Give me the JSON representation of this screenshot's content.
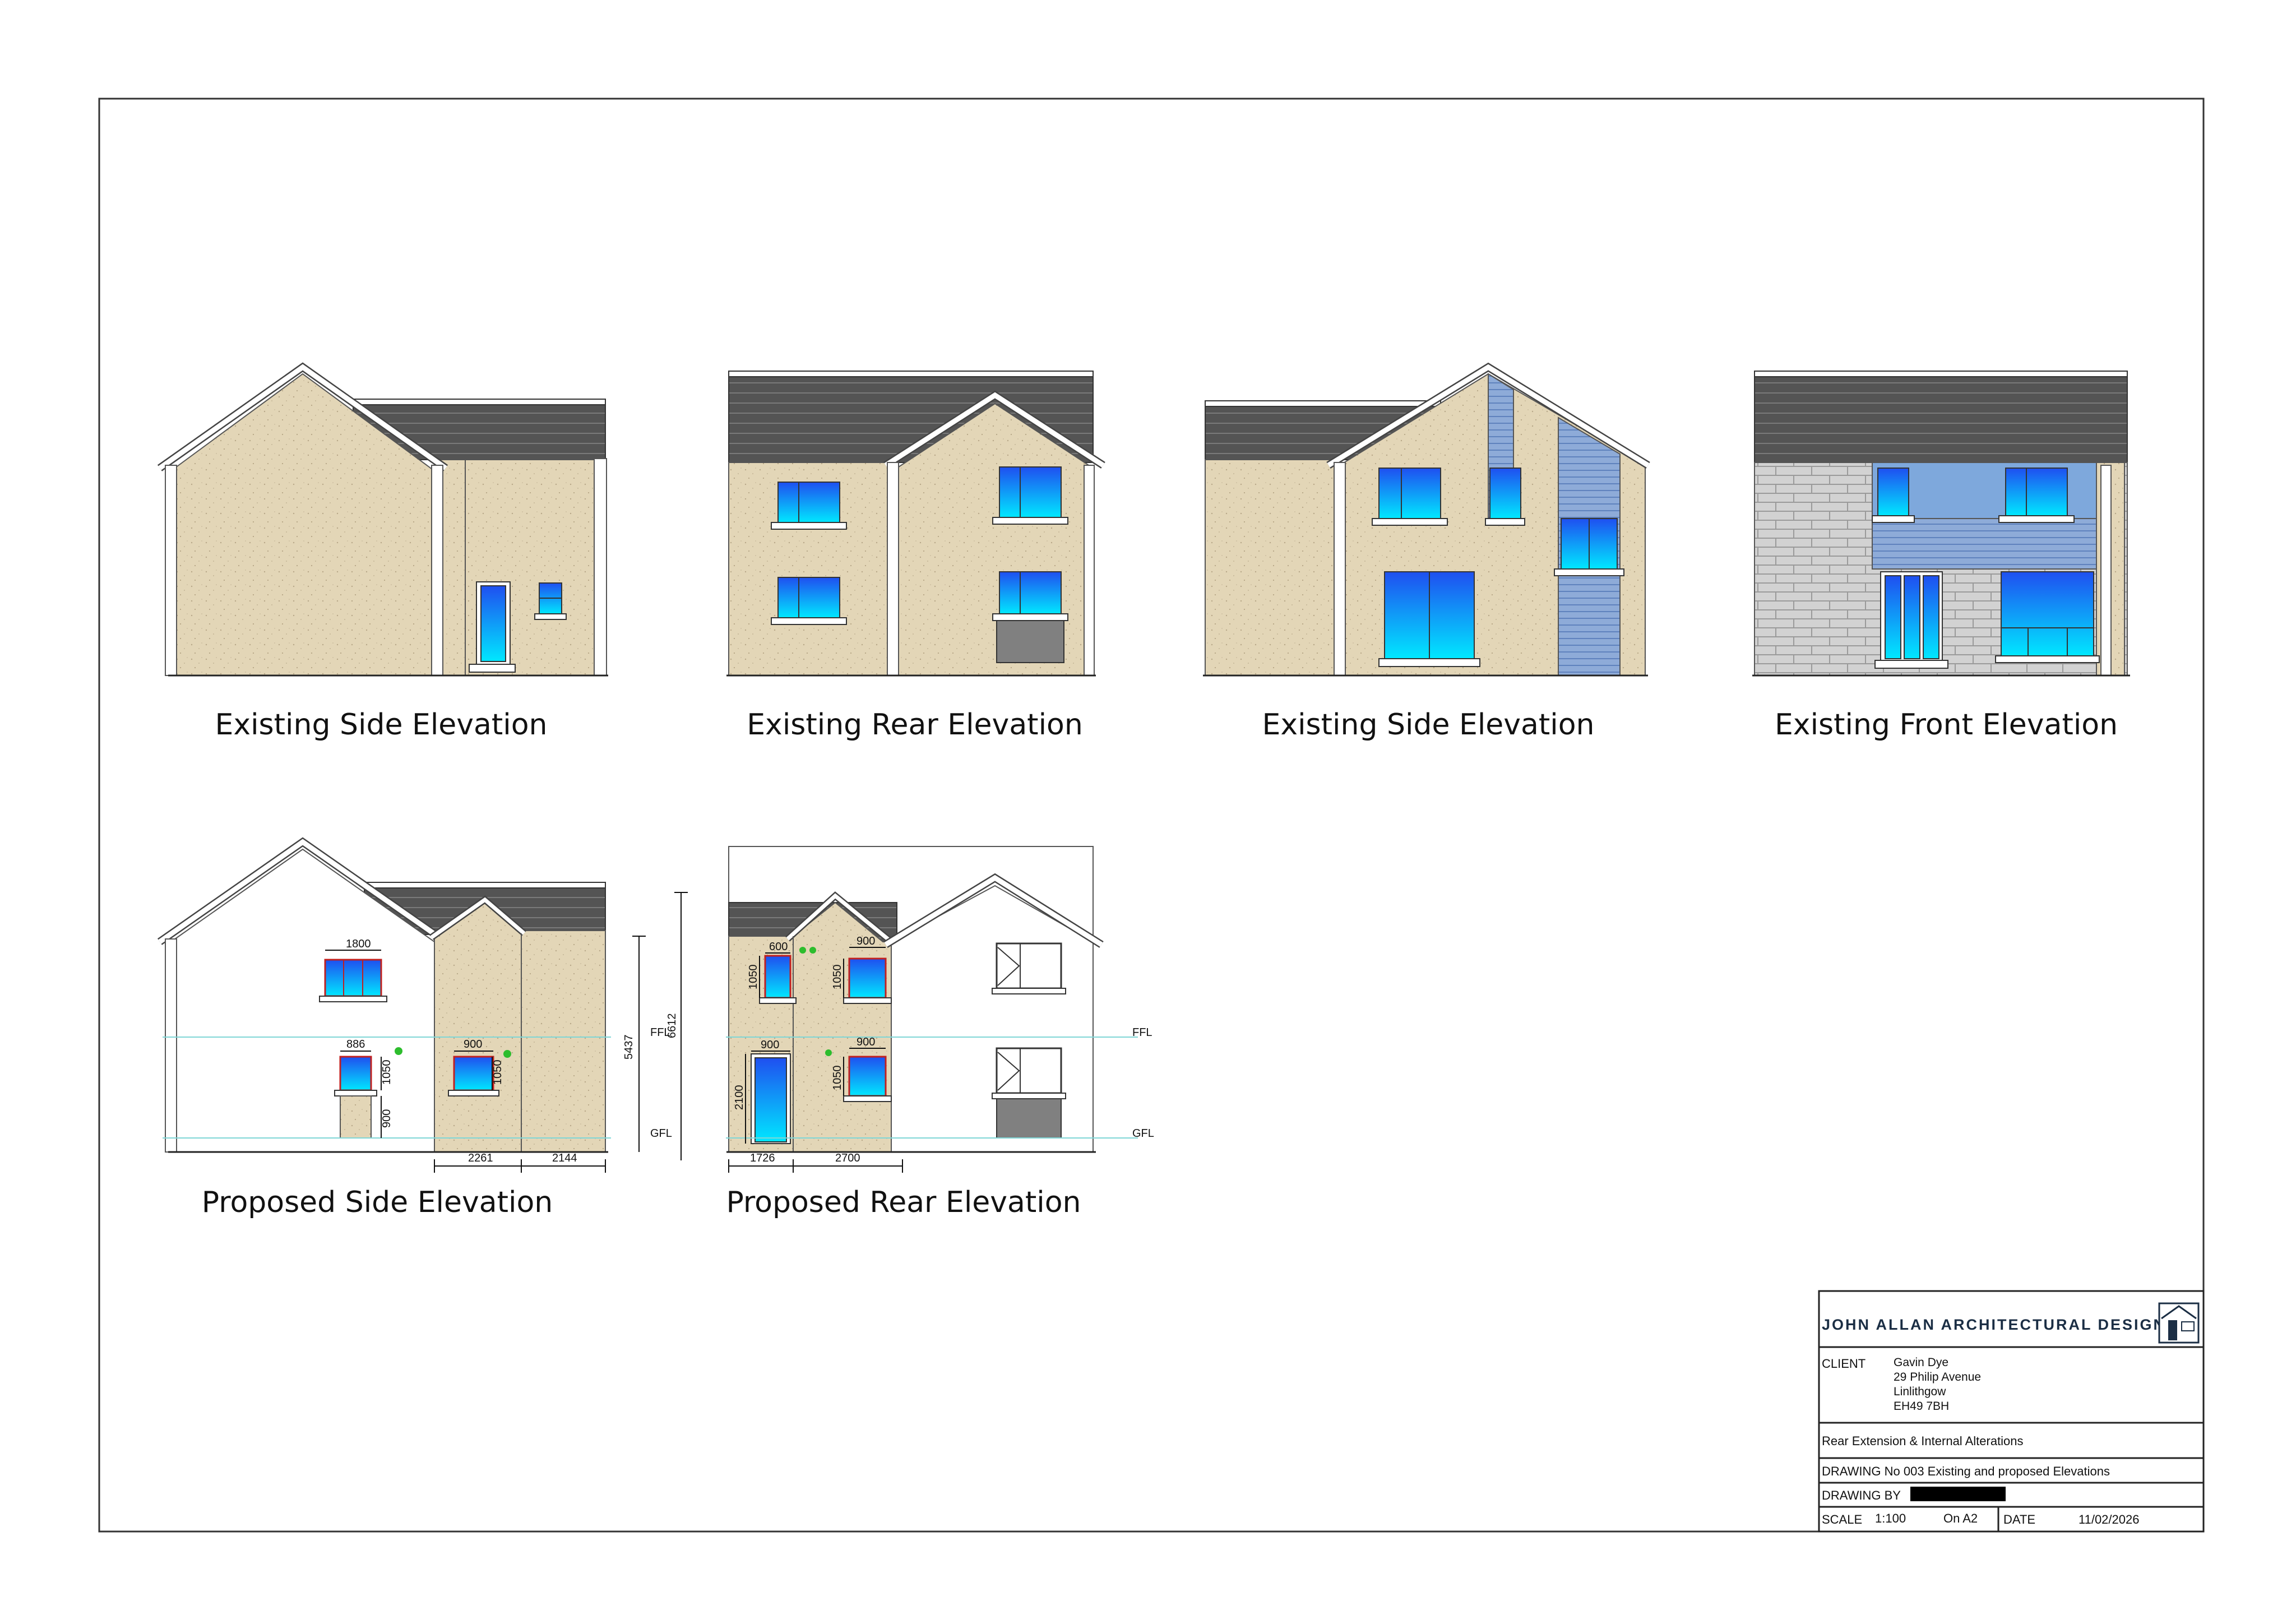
{
  "drawings": {
    "existing_side_1": "Existing Side Elevation",
    "existing_rear": "Existing Rear Elevation",
    "existing_side_2": "Existing Side Elevation",
    "existing_front": "Existing Front Elevation",
    "proposed_side": "Proposed Side Elevation",
    "proposed_rear": "Proposed Rear Elevation"
  },
  "dimensions": {
    "side_window_upper": "1800",
    "side_window_lower": "886",
    "side_window_ext": "900",
    "side_h1": "1050",
    "side_h2": "1050",
    "side_sill": "900",
    "side_overall_1": "5437",
    "side_overall_2": "6612",
    "side_base_1": "2261",
    "side_base_2": "2144",
    "rear_w1": "600",
    "rear_w2": "900",
    "rear_w3": "900",
    "rear_w4": "900",
    "rear_h1": "1050",
    "rear_h2": "1050",
    "rear_h3": "1050",
    "rear_door": "2100",
    "rear_base_1": "1726",
    "rear_base_2": "2700",
    "level_ffl": "FFL",
    "level_gfl": "GFL"
  },
  "title_block": {
    "company": "JOHN ALLAN ARCHITECTURAL DESIGN",
    "client_label": "CLIENT",
    "client_lines": [
      "Gavin Dye",
      "29 Philip Avenue",
      "Linlithgow",
      "EH49 7BH"
    ],
    "project": "Rear Extension & Internal Alterations",
    "drawing_no": "DRAWING No 003 Existing and proposed Elevations",
    "drawing_by_label": "DRAWING BY",
    "scale_label": "SCALE",
    "scale_value": "1:100",
    "sheet_size": "On A2",
    "date_label": "DATE",
    "date_value": "11/02/2026"
  },
  "colors": {
    "render": "#e3d6b7",
    "roof": "#545454",
    "glass_top": "#1f52f0",
    "glass_bottom": "#00e6ff",
    "cladding": "#8eabd8",
    "brick": "#d2d2d2",
    "dim_line": "#7fd6d6"
  }
}
